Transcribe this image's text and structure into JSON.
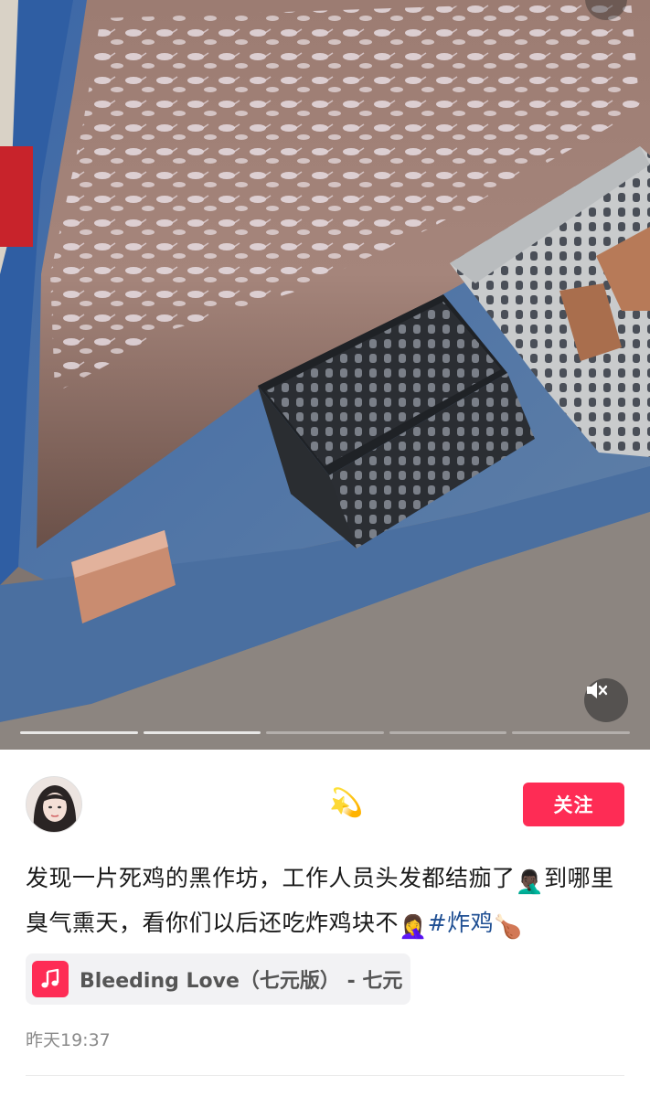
{
  "post": {
    "center_emoji": "💫",
    "follow_label": "关注",
    "caption": {
      "part1": "发现一片死鸡的黑作坊，工作人员头发都结痂了",
      "emoji1": "🤦🏿‍♂️",
      "part2": "到哪里臭气熏天，看你们以后还吃炸鸡块不",
      "emoji2": "🤦‍♀️",
      "hashtag": "#炸鸡",
      "emoji3": "🍗"
    },
    "music": {
      "icon": "music-note-icon",
      "label": "Bleeding Love（七元版） - 七元"
    },
    "timestamp": "昨天19:37"
  },
  "video": {
    "muted": true,
    "progress_segments": 5,
    "progress_filled": 2
  },
  "colors": {
    "accent": "#fe2c55",
    "hashtag": "#1f4f93",
    "timestamp": "#8a8a8a",
    "chip_bg": "#f2f2f4"
  }
}
